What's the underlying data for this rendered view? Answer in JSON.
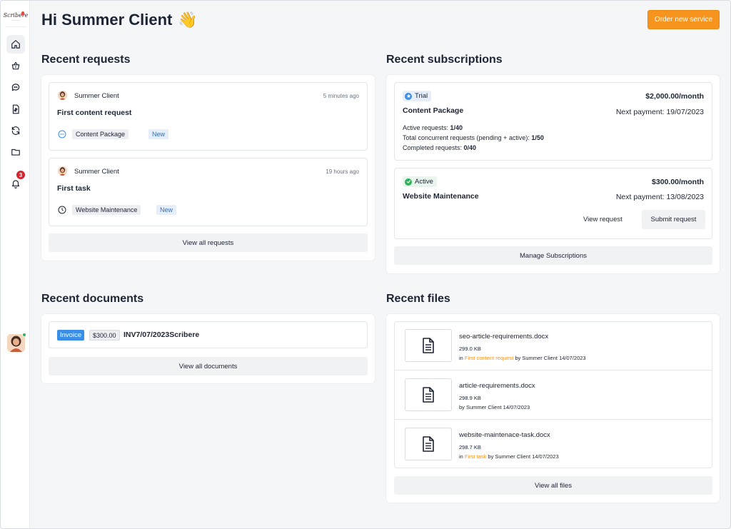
{
  "header": {
    "greeting": "Hi Summer Client",
    "wave_emoji": "👋",
    "order_button": "Order new service"
  },
  "sidebar": {
    "logo_text": "Scribere",
    "notifications_count": "3",
    "items": [
      {
        "icon": "home-icon"
      },
      {
        "icon": "basket-icon"
      },
      {
        "icon": "chat-icon"
      },
      {
        "icon": "invoice-icon"
      },
      {
        "icon": "refresh-icon"
      },
      {
        "icon": "folder-icon"
      },
      {
        "icon": "bell-icon"
      }
    ]
  },
  "requests": {
    "title": "Recent requests",
    "items": [
      {
        "user": "Summer Client",
        "time": "5 minutes ago",
        "title": "First content request",
        "service": "Content Package",
        "status": "New",
        "icon": "dots-circle-icon"
      },
      {
        "user": "Summer Client",
        "time": "19 hours ago",
        "title": "First task",
        "service": "Website Maintenance",
        "status": "New",
        "icon": "clock-icon"
      }
    ],
    "view_all": "View all requests"
  },
  "subscriptions": {
    "title": "Recent subscriptions",
    "items": [
      {
        "status": "Trial",
        "status_color": "#3b8ee8",
        "name": "Content Package",
        "price": "$2,000.00/month",
        "next_payment": "Next payment: 19/07/2023",
        "stats": [
          {
            "label": "Active requests: ",
            "value": "1/40"
          },
          {
            "label": "Total concurrent requests (pending + active): ",
            "value": "1/50"
          },
          {
            "label": "Completed requests: ",
            "value": "0/40"
          }
        ]
      },
      {
        "status": "Active",
        "status_color": "#2cb35a",
        "name": "Website Maintenance",
        "price": "$300.00/month",
        "next_payment": "Next payment: 13/08/2023",
        "view_request": "View request",
        "submit_request": "Submit request"
      }
    ],
    "manage": "Manage Subscriptions"
  },
  "documents": {
    "title": "Recent documents",
    "items": [
      {
        "type": "Invoice",
        "amount": "$300.00",
        "name": "INV7/07/2023Scribere"
      }
    ],
    "view_all": "View all documents"
  },
  "files": {
    "title": "Recent files",
    "items": [
      {
        "name": "seo-article-requirements.docx",
        "size": "299.0 KB",
        "prefix": "in ",
        "link": "First content request",
        "suffix": " by Summer Client 14/07/2023"
      },
      {
        "name": "article-requirements.docx",
        "size": "298.9 KB",
        "prefix": "",
        "link": "",
        "suffix": "by Summer Client 14/07/2023"
      },
      {
        "name": "website-maintenace-task.docx",
        "size": "298.7 KB",
        "prefix": "in ",
        "link": "First task",
        "suffix": " by Summer Client 14/07/2023"
      }
    ],
    "view_all": "View all files"
  },
  "colors": {
    "accent_orange": "#f7941d",
    "badge_red": "#d6242f",
    "invoice_blue": "#3b8ee8",
    "new_tag_bg": "#e5eef9"
  }
}
